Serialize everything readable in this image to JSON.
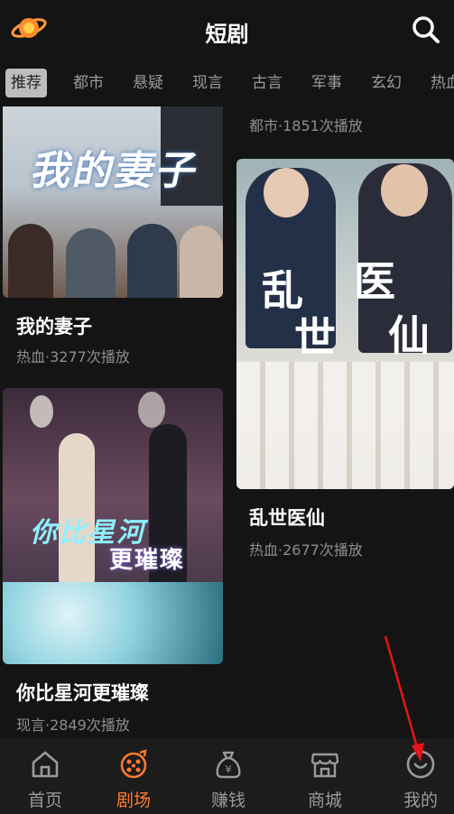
{
  "header": {
    "title": "短剧",
    "logo_icon": "planet-logo-icon",
    "search_icon": "search-icon"
  },
  "categories": [
    {
      "label": "推荐",
      "active": true
    },
    {
      "label": "都市"
    },
    {
      "label": "悬疑"
    },
    {
      "label": "现言"
    },
    {
      "label": "古言"
    },
    {
      "label": "军事"
    },
    {
      "label": "玄幻"
    },
    {
      "label": "热血"
    }
  ],
  "feed": {
    "left": [
      {
        "title": "我的妻子",
        "meta": "热血·3277次播放",
        "poster_text": "我的妻子"
      },
      {
        "title": "你比星河更璀璨",
        "meta": "现言·2849次播放",
        "poster_text_1": "你比星河",
        "poster_text_2": "更璀璨"
      }
    ],
    "right": [
      {
        "meta": "都市·1851次播放"
      },
      {
        "title": "乱世医仙",
        "meta": "热血·2677次播放",
        "poster_text_1": "乱",
        "poster_text_2": "世",
        "poster_text_3": "医",
        "poster_text_4": "仙"
      }
    ]
  },
  "bottom_nav": [
    {
      "label": "首页",
      "icon": "home-icon"
    },
    {
      "label": "剧场",
      "icon": "theater-icon",
      "active": true
    },
    {
      "label": "赚钱",
      "icon": "money-bag-icon"
    },
    {
      "label": "商城",
      "icon": "store-icon"
    },
    {
      "label": "我的",
      "icon": "profile-icon"
    }
  ],
  "colors": {
    "accent": "#ff7a2f",
    "background": "#141414",
    "annotation_arrow": "#e8141a"
  }
}
